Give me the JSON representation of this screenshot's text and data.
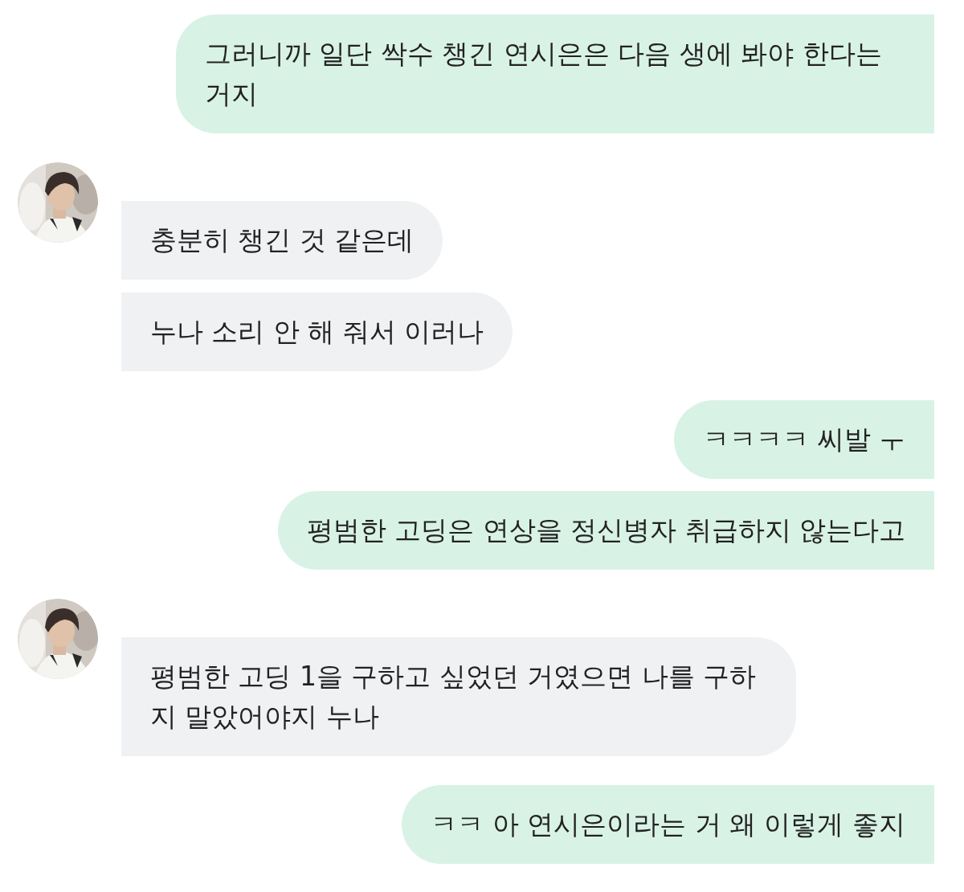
{
  "conversation": [
    {
      "kind": "outgoing",
      "messages": [
        "그러니까 일단 싹수 챙긴 연시은은 다음 생에 봐야 한다는 거지"
      ]
    },
    {
      "kind": "incoming",
      "avatar": {
        "kind": "picture"
      },
      "messages": [
        "충분히 챙긴 것 같은데",
        "누나 소리 안 해 줘서 이러나"
      ]
    },
    {
      "kind": "outgoing",
      "messages": [
        "ㅋㅋㅋㅋ 씨발 ㅜ",
        "평범한 고딩은 연상을 정신병자 취급하지 않는다고"
      ]
    },
    {
      "kind": "incoming",
      "avatar": {
        "kind": "picture"
      },
      "messages": [
        "평범한 고딩 1을 구하고 싶었던 거였으면 나를 구하지 말았어야지 누나"
      ]
    },
    {
      "kind": "outgoing",
      "messages": [
        "ㅋㅋ 아 연시은이라는 거 왜 이렇게 좋지"
      ]
    }
  ]
}
